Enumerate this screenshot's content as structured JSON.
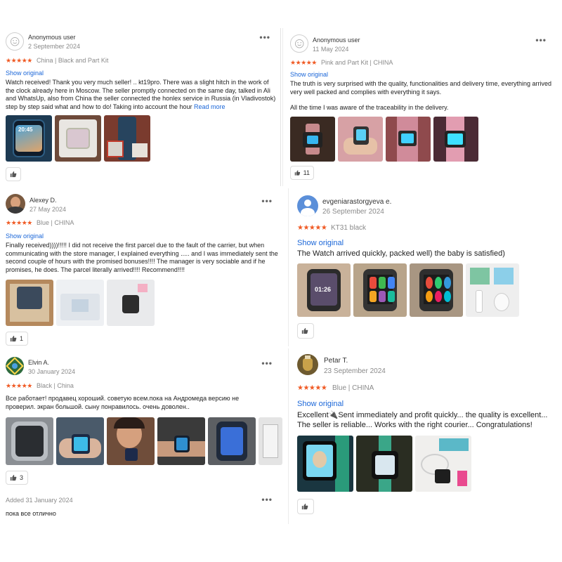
{
  "reviews": [
    {
      "name": "Anonymous user",
      "date": "2 September 2024",
      "stars": "★★★★★",
      "variant": "China | Black and Part Kit",
      "show_original": "Show original",
      "text": "Watch received! Thank you very much seller! .. kt19pro. There was a slight hitch in the work of the clock already here in Moscow. The seller promptly connected on the same day, talked in Ali and WhatsUp, also from China the seller connected the honlex service in Russia (in Vladivostok) step by step said what and how to do! Taking into account the hour",
      "read_more": "Read more",
      "likes": "",
      "more": "•••"
    },
    {
      "name": "Anonymous user",
      "date": "11 May 2024",
      "stars": "★★★★★",
      "variant": "Pink and Part Kit | CHINA",
      "show_original": "Show original",
      "text": "The truth is very surprised with the quality, functionalities and delivery time, everything arrived very well packed and complies with everything it says.",
      "text2": "All the time I was aware of the traceability in the delivery.",
      "likes": "11",
      "more": "•••"
    },
    {
      "name": "Alexey D.",
      "date": "27 May 2024",
      "stars": "★★★★★",
      "variant": "Blue | CHINA",
      "show_original": "Show original",
      "text": "Finally received))))!!!!! I did not receive the first parcel due to the fault of the carrier, but when communicating with the store manager, I explained everything ..... and I was immediately sent the second couple of hours with the promised bonuses!!!! The manager is very sociable and if he promises, he does. The parcel literally arrived!!!! Recommend!!!!",
      "likes": "1",
      "more": "•••"
    },
    {
      "name": "evgeniarastorgyeva e.",
      "date": "26 September 2024",
      "stars": "★★★★★",
      "variant": "KT31 black",
      "show_original": "Show original",
      "text": "The Watch arrived quickly, packed well) the baby is satisfied)",
      "likes": "",
      "more": "•••"
    },
    {
      "name": "Elvin A.",
      "date": "30 January 2024",
      "stars": "★★★★★",
      "variant": "Black | China",
      "text": "Все работает!  продавец хороший. советую всем.пока на Андромеда версию не проверил. экран большой. сыну понравилось.  очень доволен..",
      "likes": "3",
      "more": "•••"
    },
    {
      "name": "Petar T.",
      "date": "23 September 2024",
      "stars": "★★★★★",
      "variant": "Blue | CHINA",
      "show_original": "Show original",
      "text": "Excellent🔌Sent immediately and profit quickly... the quality is excellent... The seller is reliable... Works with the right courier... Congratulations!",
      "likes": "",
      "more": "•••"
    },
    {
      "added": "Added 31 January 2024",
      "text": "пока все отлично",
      "more": "•••"
    }
  ],
  "watch_screens": {
    "clock1": "20:45",
    "clock2": "01:26"
  },
  "colors": {
    "star": "#f05a24",
    "link": "#1a66d8"
  }
}
